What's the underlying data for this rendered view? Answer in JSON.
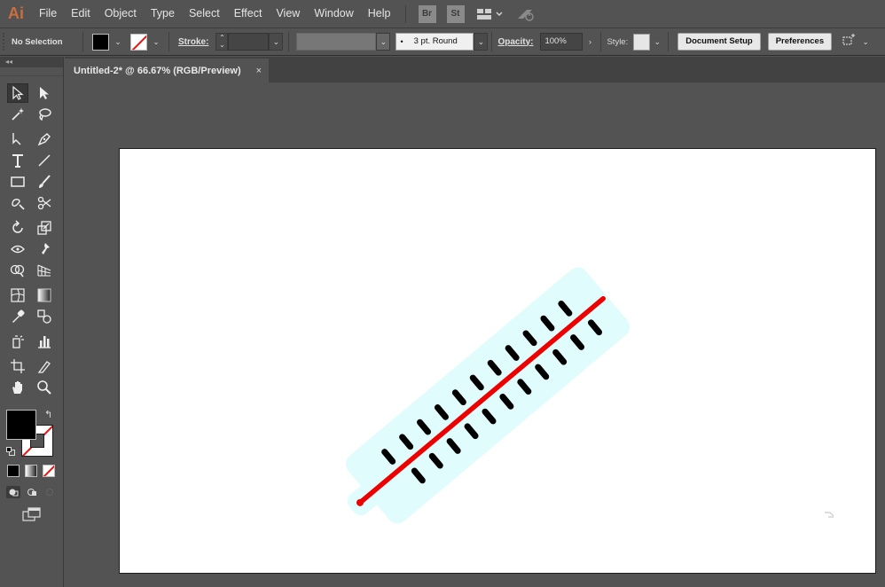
{
  "app": {
    "logo": "Ai",
    "accent": "#c96f3d"
  },
  "menu": {
    "items": [
      "File",
      "Edit",
      "Object",
      "Type",
      "Select",
      "Effect",
      "View",
      "Window",
      "Help"
    ],
    "icons": [
      {
        "label": "Br",
        "icon": "bridge-icon"
      },
      {
        "label": "St",
        "icon": "stock-icon"
      },
      {
        "label": "",
        "icon": "arrange-documents-icon"
      },
      {
        "label": "",
        "icon": "gpu-performance-icon"
      }
    ]
  },
  "control": {
    "selection": "No Selection",
    "fill_color": "#000000",
    "stroke_color": "none",
    "stroke_label": "Stroke:",
    "stroke_value": "",
    "brush_value": "3 pt. Round",
    "opacity_label": "Opacity:",
    "opacity_value": "100%",
    "style_label": "Style:",
    "document_setup": "Document Setup",
    "preferences": "Preferences"
  },
  "tools": {
    "collapse_glyph": "◂◂",
    "items": [
      "selection-tool",
      "direct-selection-tool",
      "magic-wand-tool",
      "lasso-tool",
      "pen-tool",
      "curvature-tool",
      "type-tool",
      "line-segment-tool",
      "rectangle-tool",
      "paintbrush-tool",
      "shaper-tool",
      "scissors-tool",
      "rotate-tool",
      "scale-tool",
      "width-tool",
      "puppet-warp-tool",
      "shape-builder-tool",
      "perspective-grid-tool",
      "mesh-tool",
      "gradient-tool",
      "eyedropper-tool",
      "blend-tool",
      "symbol-sprayer-tool",
      "column-graph-tool",
      "artboard-tool",
      "slice-tool",
      "hand-tool",
      "zoom-tool"
    ],
    "fill": "#000000",
    "stroke": "none"
  },
  "document": {
    "tab_title": "Untitled-2* @ 66.67% (RGB/Preview)",
    "close_glyph": "×"
  },
  "artwork": {
    "thermometer_body_color": "#e0fcfc",
    "mercury_color": "#ee0000",
    "tick_color": "#000000"
  }
}
